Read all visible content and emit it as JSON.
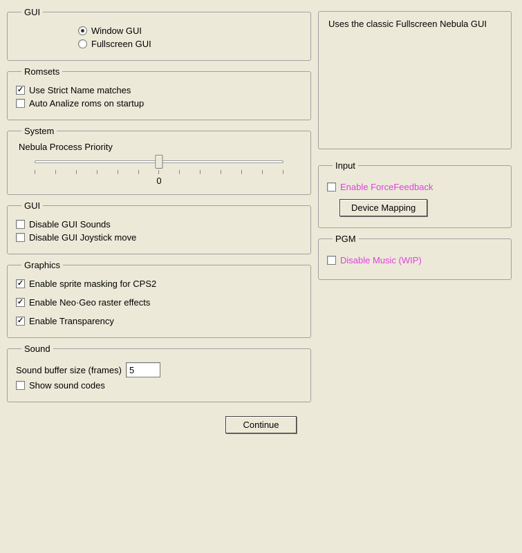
{
  "gui_mode": {
    "legend": "GUI",
    "options": [
      {
        "label": "Window GUI",
        "selected": true
      },
      {
        "label": "Fullscreen GUI",
        "selected": false
      }
    ]
  },
  "romsets": {
    "legend": "Romsets",
    "strict_label": "Use Strict Name matches",
    "strict_checked": true,
    "auto_label": "Auto Analize roms on startup",
    "auto_checked": false
  },
  "system": {
    "legend": "System",
    "priority_label": "Nebula Process Priority",
    "priority_value": "0"
  },
  "gui_opts": {
    "legend": "GUI",
    "sounds_label": "Disable GUI Sounds",
    "sounds_checked": false,
    "joy_label": "Disable GUI Joystick move",
    "joy_checked": false
  },
  "graphics": {
    "legend": "Graphics",
    "mask_label": "Enable sprite masking for CPS2",
    "mask_checked": true,
    "raster_label": "Enable Neo·Geo raster effects",
    "raster_checked": true,
    "trans_label": "Enable Transparency",
    "trans_checked": true
  },
  "sound": {
    "legend": "Sound",
    "buffer_label": "Sound buffer size (frames)",
    "buffer_value": "5",
    "codes_label": "Show sound codes",
    "codes_checked": false
  },
  "description": "Uses the classic Fullscreen Nebula GUI",
  "input": {
    "legend": "Input",
    "ff_label": "Enable ForceFeedback",
    "ff_checked": false,
    "mapping_label": "Device Mapping"
  },
  "pgm": {
    "legend": "PGM",
    "music_label": "Disable Music (WIP)",
    "music_checked": false
  },
  "continue_label": "Continue"
}
